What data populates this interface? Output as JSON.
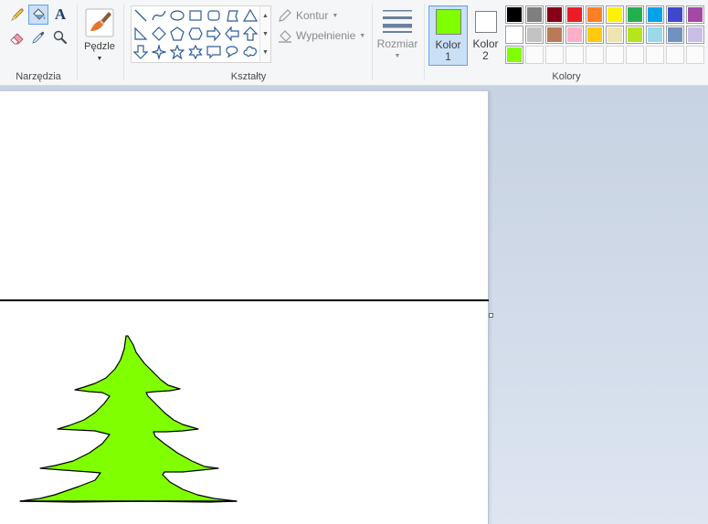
{
  "ribbon": {
    "tools": {
      "label": "Narzędzia"
    },
    "brushes": {
      "label": "Pędzle"
    },
    "shapes": {
      "label": "Kształty",
      "outline_label": "Kontur",
      "fill_label": "Wypełnienie"
    },
    "size": {
      "label": "Rozmiar"
    },
    "color1": {
      "label_line1": "Kolor",
      "label_line2": "1",
      "color": "#7fff00"
    },
    "color2": {
      "label_line1": "Kolor",
      "label_line2": "2",
      "color": "#ffffff"
    },
    "colors": {
      "label": "Kolory"
    },
    "palette": {
      "row1": [
        "#000000",
        "#7f7f7f",
        "#880015",
        "#ed1c24",
        "#ff7f27",
        "#fff200",
        "#22b14c",
        "#00a2e8",
        "#3f48cc",
        "#a349a4"
      ],
      "row2": [
        "#ffffff",
        "#c3c3c3",
        "#b97a57",
        "#ffaec9",
        "#ffc90e",
        "#efe4b0",
        "#b5e61d",
        "#99d9ea",
        "#7092be",
        "#c8bfe7"
      ],
      "row3": [
        "#7fff00"
      ]
    }
  },
  "canvas": {
    "background": "#ffffff",
    "drawing": {
      "line_color": "#000000",
      "tree_fill": "#7fff00"
    }
  }
}
